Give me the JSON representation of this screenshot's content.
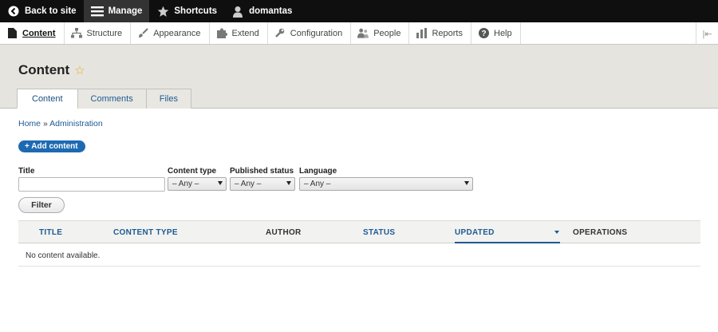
{
  "toolbar": {
    "back": "Back to site",
    "manage": "Manage",
    "shortcuts": "Shortcuts",
    "user": "domantas"
  },
  "tray": {
    "items": [
      "Content",
      "Structure",
      "Appearance",
      "Extend",
      "Configuration",
      "People",
      "Reports",
      "Help"
    ]
  },
  "page": {
    "title": "Content",
    "tabs": [
      "Content",
      "Comments",
      "Files"
    ]
  },
  "breadcrumb": {
    "home": "Home",
    "sep": "»",
    "admin": "Administration"
  },
  "add_button": "+ Add content",
  "filters": {
    "title_label": "Title",
    "title_value": "",
    "type_label": "Content type",
    "type_value": "– Any –",
    "status_label": "Published status",
    "status_value": "– Any –",
    "lang_label": "Language",
    "lang_value": "– Any –",
    "submit": "Filter"
  },
  "table": {
    "columns": [
      "TITLE",
      "CONTENT TYPE",
      "AUTHOR",
      "STATUS",
      "UPDATED",
      "OPERATIONS"
    ],
    "empty": "No content available."
  },
  "colors": {
    "link": "#1e5a93",
    "button": "#1d6ab2",
    "toolbar": "#0f0f0f"
  }
}
